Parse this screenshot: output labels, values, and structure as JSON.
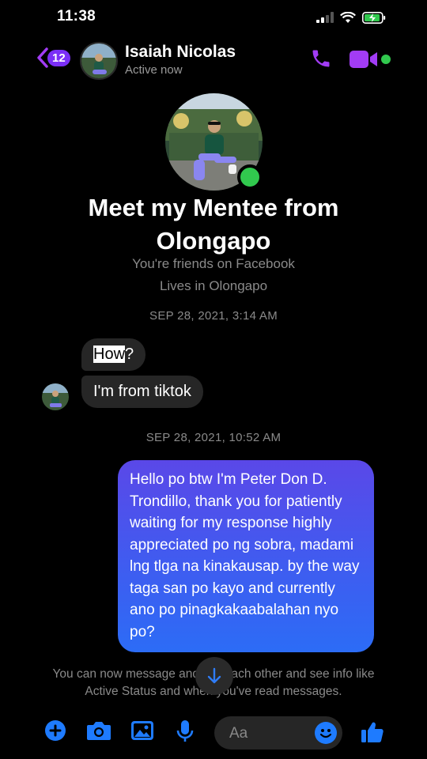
{
  "status_bar": {
    "time": "11:38"
  },
  "header": {
    "back_badge": "12",
    "contact_name": "Isaiah Nicolas",
    "contact_status": "Active now"
  },
  "profile": {
    "overlay_caption": "Meet my Mentee from Olongapo",
    "friends_line": "You're friends on Facebook",
    "lives_line": "Lives in Olongapo"
  },
  "messages": {
    "timestamp_1": "SEP 28, 2021, 3:14 AM",
    "incoming_1_highlight": "How",
    "incoming_1_rest": "?",
    "incoming_2": "I'm from tiktok",
    "timestamp_2": "SEP 28, 2021, 10:52 AM",
    "outgoing_1": "Hello po btw I'm Peter Don D. Trondillo, thank you for patiently waiting for my response highly appreciated po ng sobra, madami lng tlga na kinakausap. by the way taga san po kayo and currently ano po pinagkakaabalahan nyo po?"
  },
  "footer": {
    "note": "You can now message and call each other and see info like Active Status and when you've read messages."
  },
  "composer": {
    "placeholder": "Aa"
  },
  "colors": {
    "accent_purple": "#a23cf5",
    "accent_blue": "#1e7bff",
    "online_green": "#31c94e",
    "incoming_bubble": "#262626"
  },
  "icons": [
    "back-chevron-icon",
    "phone-icon",
    "video-camera-icon",
    "plus-icon",
    "camera-icon",
    "gallery-icon",
    "microphone-icon",
    "emoji-icon",
    "thumbs-up-icon",
    "arrow-down-icon"
  ]
}
